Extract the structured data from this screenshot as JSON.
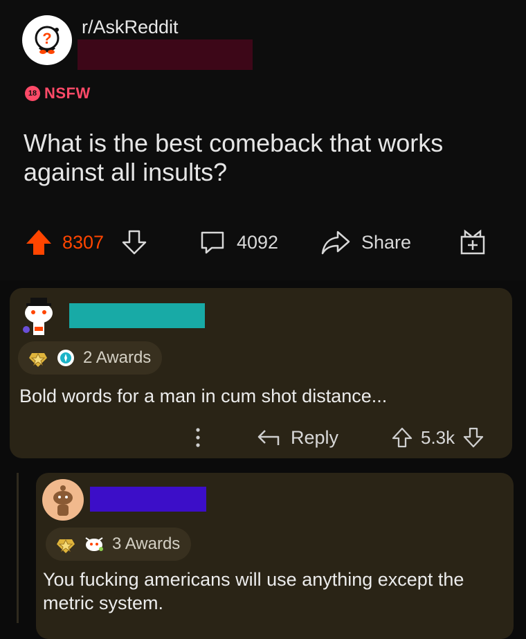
{
  "post": {
    "subreddit": "r/AskReddit",
    "nsfw_badge": "18",
    "nsfw_label": "NSFW",
    "title": "What is the best comeback that works against all insults?",
    "upvotes": "8307",
    "comments": "4092",
    "share_label": "Share"
  },
  "comments": [
    {
      "awards_label": "2 Awards",
      "text": "Bold words for a man in cum shot distance...",
      "reply_label": "Reply",
      "score": "5.3k",
      "redaction_color": "#18aaa6"
    },
    {
      "awards_label": "3 Awards",
      "text": "You fucking americans will use anything except the metric system.",
      "redaction_color": "#3c0ec8"
    }
  ],
  "colors": {
    "upvote_active": "#ff4500",
    "nsfw": "#ff4a68",
    "comment_bg": "#2a2416",
    "user_redaction": "#3d0718"
  },
  "icons": [
    "subreddit-avatar-icon",
    "upvote-icon",
    "downvote-icon",
    "comment-icon",
    "share-icon",
    "gift-icon",
    "award-icon",
    "more-icon",
    "reply-icon"
  ]
}
